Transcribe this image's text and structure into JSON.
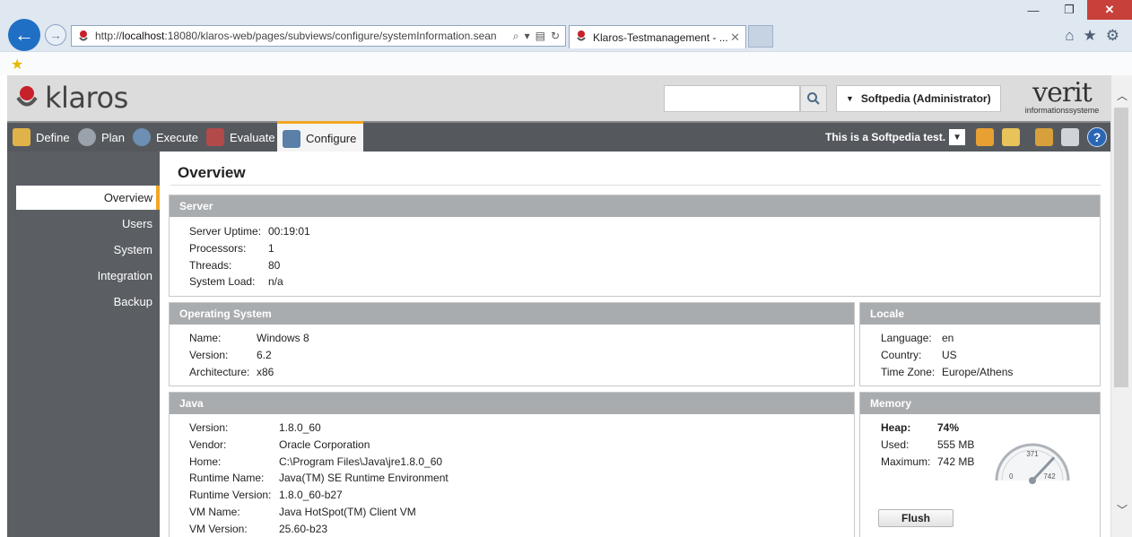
{
  "browser": {
    "url_prefix": "http://",
    "url_host": "localhost",
    "url_rest": ":18080/klaros-web/pages/subviews/configure/systemInformation.sean",
    "tab_title": "Klaros-Testmanagement - ...",
    "window_buttons": [
      "—",
      "❐",
      "✕"
    ]
  },
  "header": {
    "logo_text": "klaros",
    "search_placeholder": "",
    "user": "Softpedia (Administrator)",
    "partner_logo": "verit",
    "partner_sub": "informationssysteme"
  },
  "toolbar": {
    "items": [
      {
        "label": "Define",
        "icon": "define-icon",
        "color": "#e0b24a"
      },
      {
        "label": "Plan",
        "icon": "plan-icon",
        "color": "#9aa3ab"
      },
      {
        "label": "Execute",
        "icon": "execute-icon",
        "color": "#6d8fb3"
      },
      {
        "label": "Evaluate",
        "icon": "evaluate-icon",
        "color": "#b24a4a"
      },
      {
        "label": "Configure",
        "icon": "configure-icon",
        "color": "#5a7fa8"
      }
    ],
    "notice": "This is a Softpedia test.",
    "help": "?"
  },
  "sidebar": {
    "items": [
      {
        "label": "Overview",
        "active": true
      },
      {
        "label": "Users",
        "active": false
      },
      {
        "label": "System",
        "active": false
      },
      {
        "label": "Integration",
        "active": false
      },
      {
        "label": "Backup",
        "active": false
      }
    ]
  },
  "main": {
    "title": "Overview",
    "server": {
      "title": "Server",
      "rows": [
        {
          "k": "Server Uptime:",
          "v": "00:19:01"
        },
        {
          "k": "Processors:",
          "v": "1"
        },
        {
          "k": "Threads:",
          "v": "80"
        },
        {
          "k": "System Load:",
          "v": "n/a"
        }
      ]
    },
    "os": {
      "title": "Operating System",
      "rows": [
        {
          "k": "Name:",
          "v": "Windows 8"
        },
        {
          "k": "Version:",
          "v": "6.2"
        },
        {
          "k": "Architecture:",
          "v": "x86"
        }
      ]
    },
    "locale": {
      "title": "Locale",
      "rows": [
        {
          "k": "Language:",
          "v": "en"
        },
        {
          "k": "Country:",
          "v": "US"
        },
        {
          "k": "Time Zone:",
          "v": "Europe/Athens"
        }
      ]
    },
    "java": {
      "title": "Java",
      "rows": [
        {
          "k": "Version:",
          "v": "1.8.0_60"
        },
        {
          "k": "Vendor:",
          "v": "Oracle Corporation"
        },
        {
          "k": "Home:",
          "v": "C:\\Program Files\\Java\\jre1.8.0_60"
        },
        {
          "k": "Runtime Name:",
          "v": "Java(TM) SE Runtime Environment"
        },
        {
          "k": "Runtime Version:",
          "v": "1.8.0_60-b27"
        },
        {
          "k": "VM Name:",
          "v": "Java HotSpot(TM) Client VM"
        },
        {
          "k": "VM Version:",
          "v": "25.60-b23"
        }
      ]
    },
    "memory": {
      "title": "Memory",
      "rows": [
        {
          "k": "Heap:",
          "v": "74%"
        },
        {
          "k": "Used:",
          "v": "555 MB"
        },
        {
          "k": "Maximum:",
          "v": "742 MB"
        }
      ],
      "gauge": {
        "min": "0",
        "mid": "371",
        "max": "742",
        "value_fraction": 0.74
      },
      "flush_label": "Flush"
    }
  }
}
